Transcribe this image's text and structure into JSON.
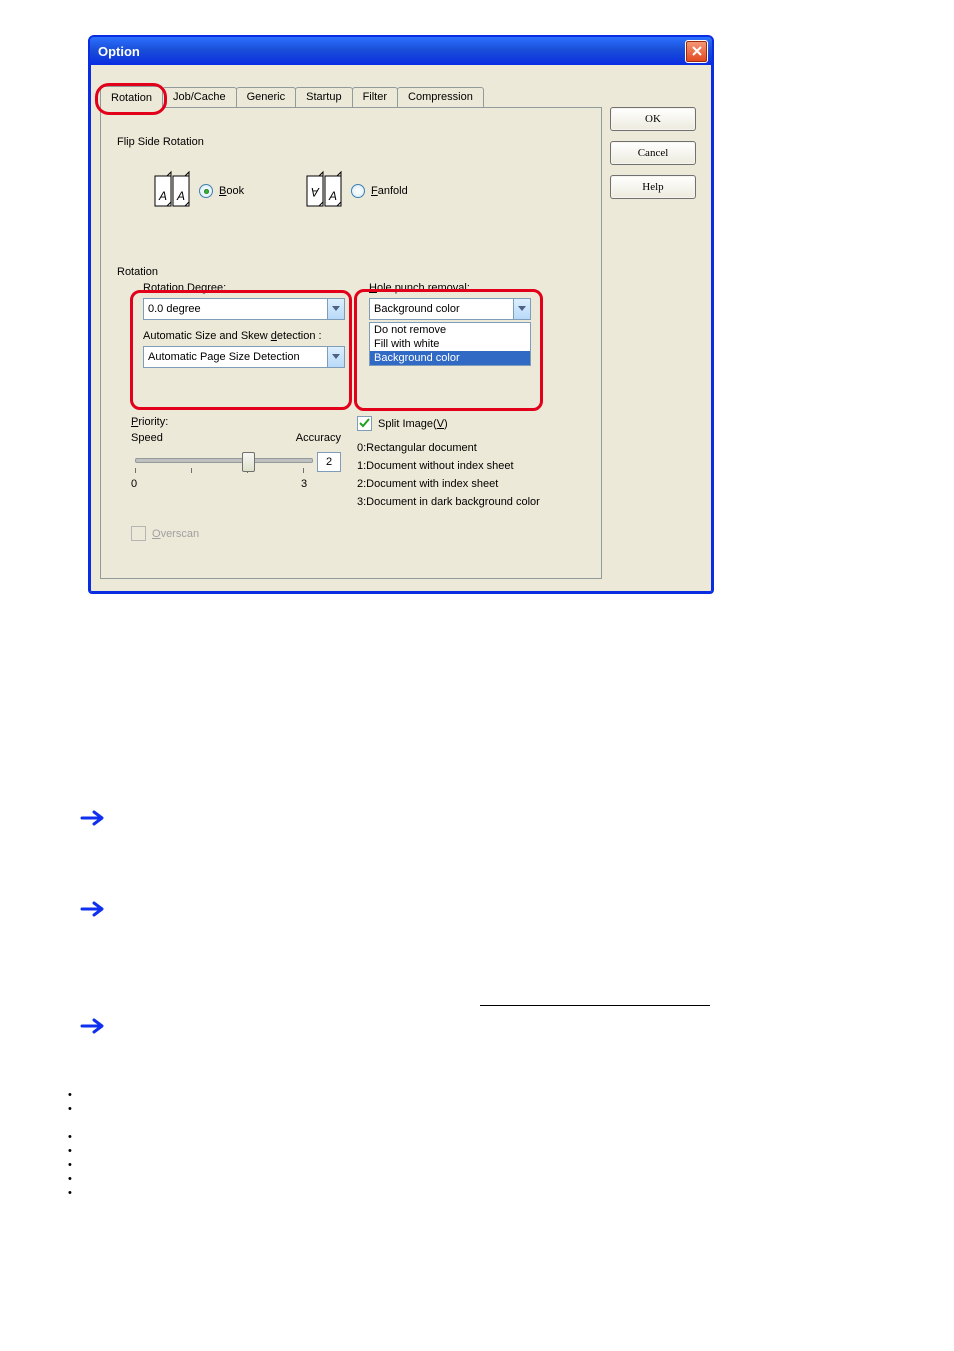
{
  "title": "Option",
  "tabs": [
    "Rotation",
    "Job/Cache",
    "Generic",
    "Startup",
    "Filter",
    "Compression"
  ],
  "buttons": {
    "ok": "OK",
    "cancel": "Cancel",
    "help": "Help"
  },
  "flip": {
    "section": "Flip Side Rotation",
    "book_prefix": "B",
    "book_rest": "ook",
    "fan_prefix": "F",
    "fan_rest": "anfold"
  },
  "rotation": {
    "section": "Rotation",
    "degree_lbl_prefix": "R",
    "degree_lbl_rest": "otation Degree:",
    "degree_val": "0.0 degree",
    "autosize_lbl_pre": "Automatic Size and Skew ",
    "autosize_lbl_u": "d",
    "autosize_lbl_post": "etection :",
    "autosize_val": "Automatic Page Size Detection",
    "hole_lbl_prefix": "H",
    "hole_lbl_rest": "ole punch removal:",
    "hole_val": "Background color",
    "hole_list": [
      "Do not remove",
      "Fill with white",
      "Background color"
    ]
  },
  "priority": {
    "lbl_prefix": "P",
    "lbl_rest": "riority:",
    "left": "Speed",
    "right": "Accuracy",
    "value": "2",
    "min": "0",
    "max": "3"
  },
  "overscan": {
    "lbl_prefix": "O",
    "lbl_rest": "verscan"
  },
  "split": {
    "lbl_pre": "Split Image(",
    "lbl_u": "V",
    "lbl_post": ")",
    "lines": [
      "0:Rectangular document",
      "1:Document without index sheet",
      "2:Document with index sheet",
      "3:Document in dark background color"
    ]
  }
}
